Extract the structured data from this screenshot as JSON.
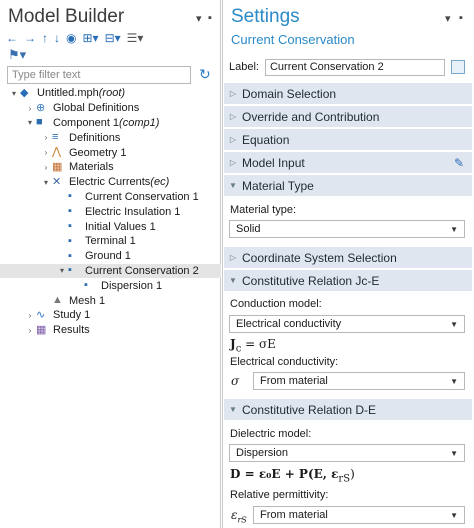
{
  "model_builder": {
    "title": "Model Builder",
    "filter_placeholder": "Type filter text",
    "tree": [
      {
        "label": "Untitled.mph",
        "suffix": " (root)",
        "indent": 0,
        "twisty": "▾",
        "icon": "file-icon",
        "icon_glyph": "◆",
        "icon_color": "#2a6db8"
      },
      {
        "label": "Global Definitions",
        "suffix": "",
        "indent": 1,
        "twisty": "›",
        "icon": "globe-icon",
        "icon_glyph": "⊕",
        "icon_color": "#3b7fc4"
      },
      {
        "label": "Component 1",
        "suffix": " (comp1)",
        "indent": 1,
        "twisty": "▾",
        "icon": "component-icon",
        "icon_glyph": "■",
        "icon_color": "#2b6cb0"
      },
      {
        "label": "Definitions",
        "suffix": "",
        "indent": 2,
        "twisty": "›",
        "icon": "definitions-icon",
        "icon_glyph": "≡",
        "icon_color": "#2a6db8"
      },
      {
        "label": "Geometry 1",
        "suffix": "",
        "indent": 2,
        "twisty": "›",
        "icon": "geometry-icon",
        "icon_glyph": "⋀",
        "icon_color": "#d07a2a"
      },
      {
        "label": "Materials",
        "suffix": "",
        "indent": 2,
        "twisty": "›",
        "icon": "materials-icon",
        "icon_glyph": "▦",
        "icon_color": "#c26b2b"
      },
      {
        "label": "Electric Currents",
        "suffix": " (ec)",
        "indent": 2,
        "twisty": "▾",
        "icon": "physics-icon",
        "icon_glyph": "✕",
        "icon_color": "#3b6aa8"
      },
      {
        "label": "Current Conservation 1",
        "suffix": "",
        "indent": 3,
        "twisty": "",
        "icon": "node-icon",
        "icon_glyph": "▪",
        "icon_color": "#2b6cb0"
      },
      {
        "label": "Electric Insulation 1",
        "suffix": "",
        "indent": 3,
        "twisty": "",
        "icon": "node-icon",
        "icon_glyph": "▪",
        "icon_color": "#2b6cb0"
      },
      {
        "label": "Initial Values 1",
        "suffix": "",
        "indent": 3,
        "twisty": "",
        "icon": "node-icon",
        "icon_glyph": "▪",
        "icon_color": "#2b6cb0"
      },
      {
        "label": "Terminal 1",
        "suffix": "",
        "indent": 3,
        "twisty": "",
        "icon": "node-icon",
        "icon_glyph": "▪",
        "icon_color": "#2b6cb0"
      },
      {
        "label": "Ground 1",
        "suffix": "",
        "indent": 3,
        "twisty": "",
        "icon": "node-icon",
        "icon_glyph": "▪",
        "icon_color": "#2b6cb0"
      },
      {
        "label": "Current Conservation 2",
        "suffix": "",
        "indent": 3,
        "twisty": "▾",
        "icon": "node-icon",
        "icon_glyph": "▪",
        "icon_color": "#2b6cb0",
        "selected": true
      },
      {
        "label": "Dispersion 1",
        "suffix": "",
        "indent": 4,
        "twisty": "",
        "icon": "subnode-icon",
        "icon_glyph": "▪",
        "icon_color": "#2b6cb0"
      },
      {
        "label": "Mesh 1",
        "suffix": "",
        "indent": 2,
        "twisty": "",
        "icon": "mesh-icon",
        "icon_glyph": "▲",
        "icon_color": "#777777"
      },
      {
        "label": "Study 1",
        "suffix": "",
        "indent": 1,
        "twisty": "›",
        "icon": "study-icon",
        "icon_glyph": "∿",
        "icon_color": "#2a79c9"
      },
      {
        "label": "Results",
        "suffix": "",
        "indent": 1,
        "twisty": "›",
        "icon": "results-icon",
        "icon_glyph": "▦",
        "icon_color": "#7a5aa8"
      }
    ]
  },
  "settings": {
    "title": "Settings",
    "subtitle": "Current Conservation",
    "label_key": "Label:",
    "label_value": "Current Conservation 2",
    "sections": {
      "domain_selection": "Domain Selection",
      "override": "Override and Contribution",
      "equation": "Equation",
      "model_input": "Model Input",
      "material_type": "Material Type",
      "coord_system": "Coordinate System Selection",
      "constitutive_jc": "Constitutive Relation Jc-E",
      "constitutive_de": "Constitutive Relation D-E"
    },
    "material_type_label": "Material type:",
    "material_type_value": "Solid",
    "conduction_model_label": "Conduction model:",
    "conduction_model_value": "Electrical conductivity",
    "jc_equation": "J",
    "jc_sub": "c",
    "jc_rhs": " = σE",
    "conductivity_label": "Electrical conductivity:",
    "sigma_symbol": "σ",
    "conductivity_value": "From material",
    "dielectric_model_label": "Dielectric model:",
    "dielectric_model_value": "Dispersion",
    "d_equation": "D = ε₀E + P(E, ε",
    "d_sub": "rS",
    "d_close": ")",
    "permittivity_label": "Relative permittivity:",
    "eps_symbol": "ε",
    "eps_sub": "rS",
    "permittivity_value": "From material"
  },
  "colors": {
    "accent": "#2a8ac9",
    "section_header": "#dfe6ef",
    "selection": "#e4e4e4"
  }
}
